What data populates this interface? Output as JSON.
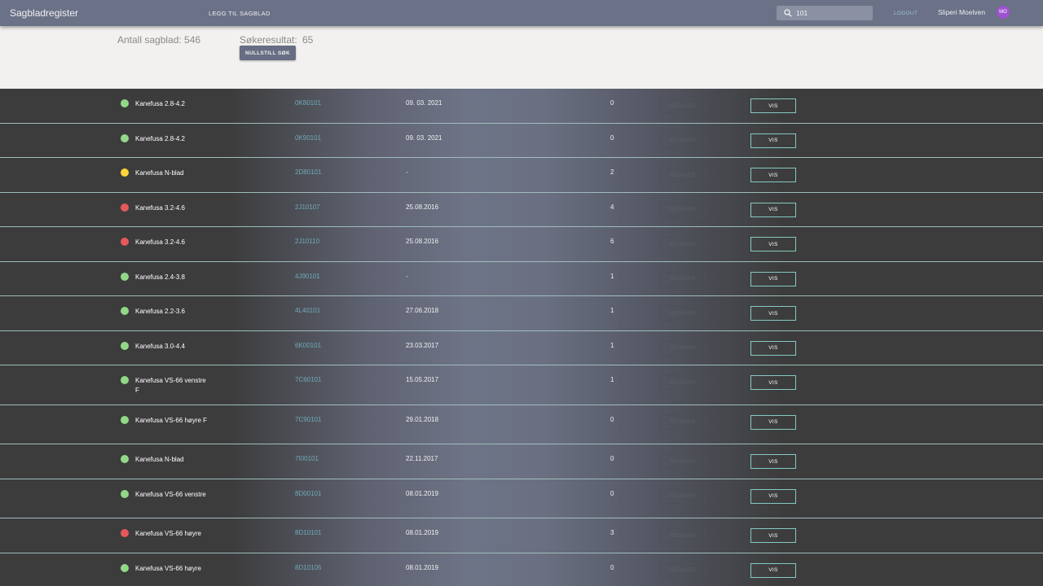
{
  "header": {
    "title": "Sagbladregister",
    "add_link": "LEGG TIL SAGBLAD",
    "search_value": "101",
    "logout": "LOGOUT",
    "user_name": "Sliperi Moelven",
    "avatar_initials": "MO"
  },
  "stats": {
    "count_text": "Antall sagblad: 546",
    "result_label": "Søkeresultat:",
    "result_value": "65",
    "reset_button": "NULLSTILL SØK"
  },
  "buttons": {
    "edit_label": "REDIGER",
    "view_label": "VIS"
  },
  "colors": {
    "green": "#92d987",
    "yellow": "#fdd43a",
    "red": "#e5595b"
  },
  "rows": [
    {
      "name": "Kanefusa 2.8-4.2",
      "code": "0K80101",
      "date": "09. 03. 2021",
      "count": "0",
      "status": "green"
    },
    {
      "name": "Kanefusa 2.8-4.2",
      "code": "0K90101",
      "date": "09. 03. 2021",
      "count": "0",
      "status": "green"
    },
    {
      "name": "Kanefusa N-blad",
      "code": "2D80101",
      "date": "-",
      "count": "2",
      "status": "yellow"
    },
    {
      "name": "Kanefusa 3.2-4.6",
      "code": "2J10107",
      "date": "25.08.2016",
      "count": "4",
      "status": "red"
    },
    {
      "name": "Kanefusa 3.2-4.6",
      "code": "2J10110",
      "date": "25.08.2016",
      "count": "6",
      "status": "red"
    },
    {
      "name": "Kanefusa 2.4-3.8",
      "code": "4J90101",
      "date": "-",
      "count": "1",
      "status": "green"
    },
    {
      "name": "Kanefusa 2.2-3.6",
      "code": "4L40101",
      "date": "27.06.2018",
      "count": "1",
      "status": "green"
    },
    {
      "name": "Kanefusa 3.0-4.4",
      "code": "6K00101",
      "date": "23.03.2017",
      "count": "1",
      "status": "green"
    },
    {
      "name": "Kanefusa VS-66 venstre F",
      "code": "7C60101",
      "date": "15.05.2017",
      "count": "1",
      "status": "green"
    },
    {
      "name": "Kanefusa VS-66 høyre F",
      "code": "7C90101",
      "date": "29.01.2018",
      "count": "0",
      "status": "green"
    },
    {
      "name": "Kanefusa N-blad",
      "code": "7I00101",
      "date": "22.11.2017",
      "count": "0",
      "status": "green"
    },
    {
      "name": "Kanefusa VS-66 venstre",
      "code": "8D00101",
      "date": "08.01.2019",
      "count": "0",
      "status": "green"
    },
    {
      "name": "Kanefusa VS-66 høyre",
      "code": "8D10101",
      "date": "08.01.2019",
      "count": "3",
      "status": "red"
    },
    {
      "name": "Kanefusa VS-66 høyre",
      "code": "8D10105",
      "date": "08.01.2019",
      "count": "0",
      "status": "green"
    }
  ]
}
